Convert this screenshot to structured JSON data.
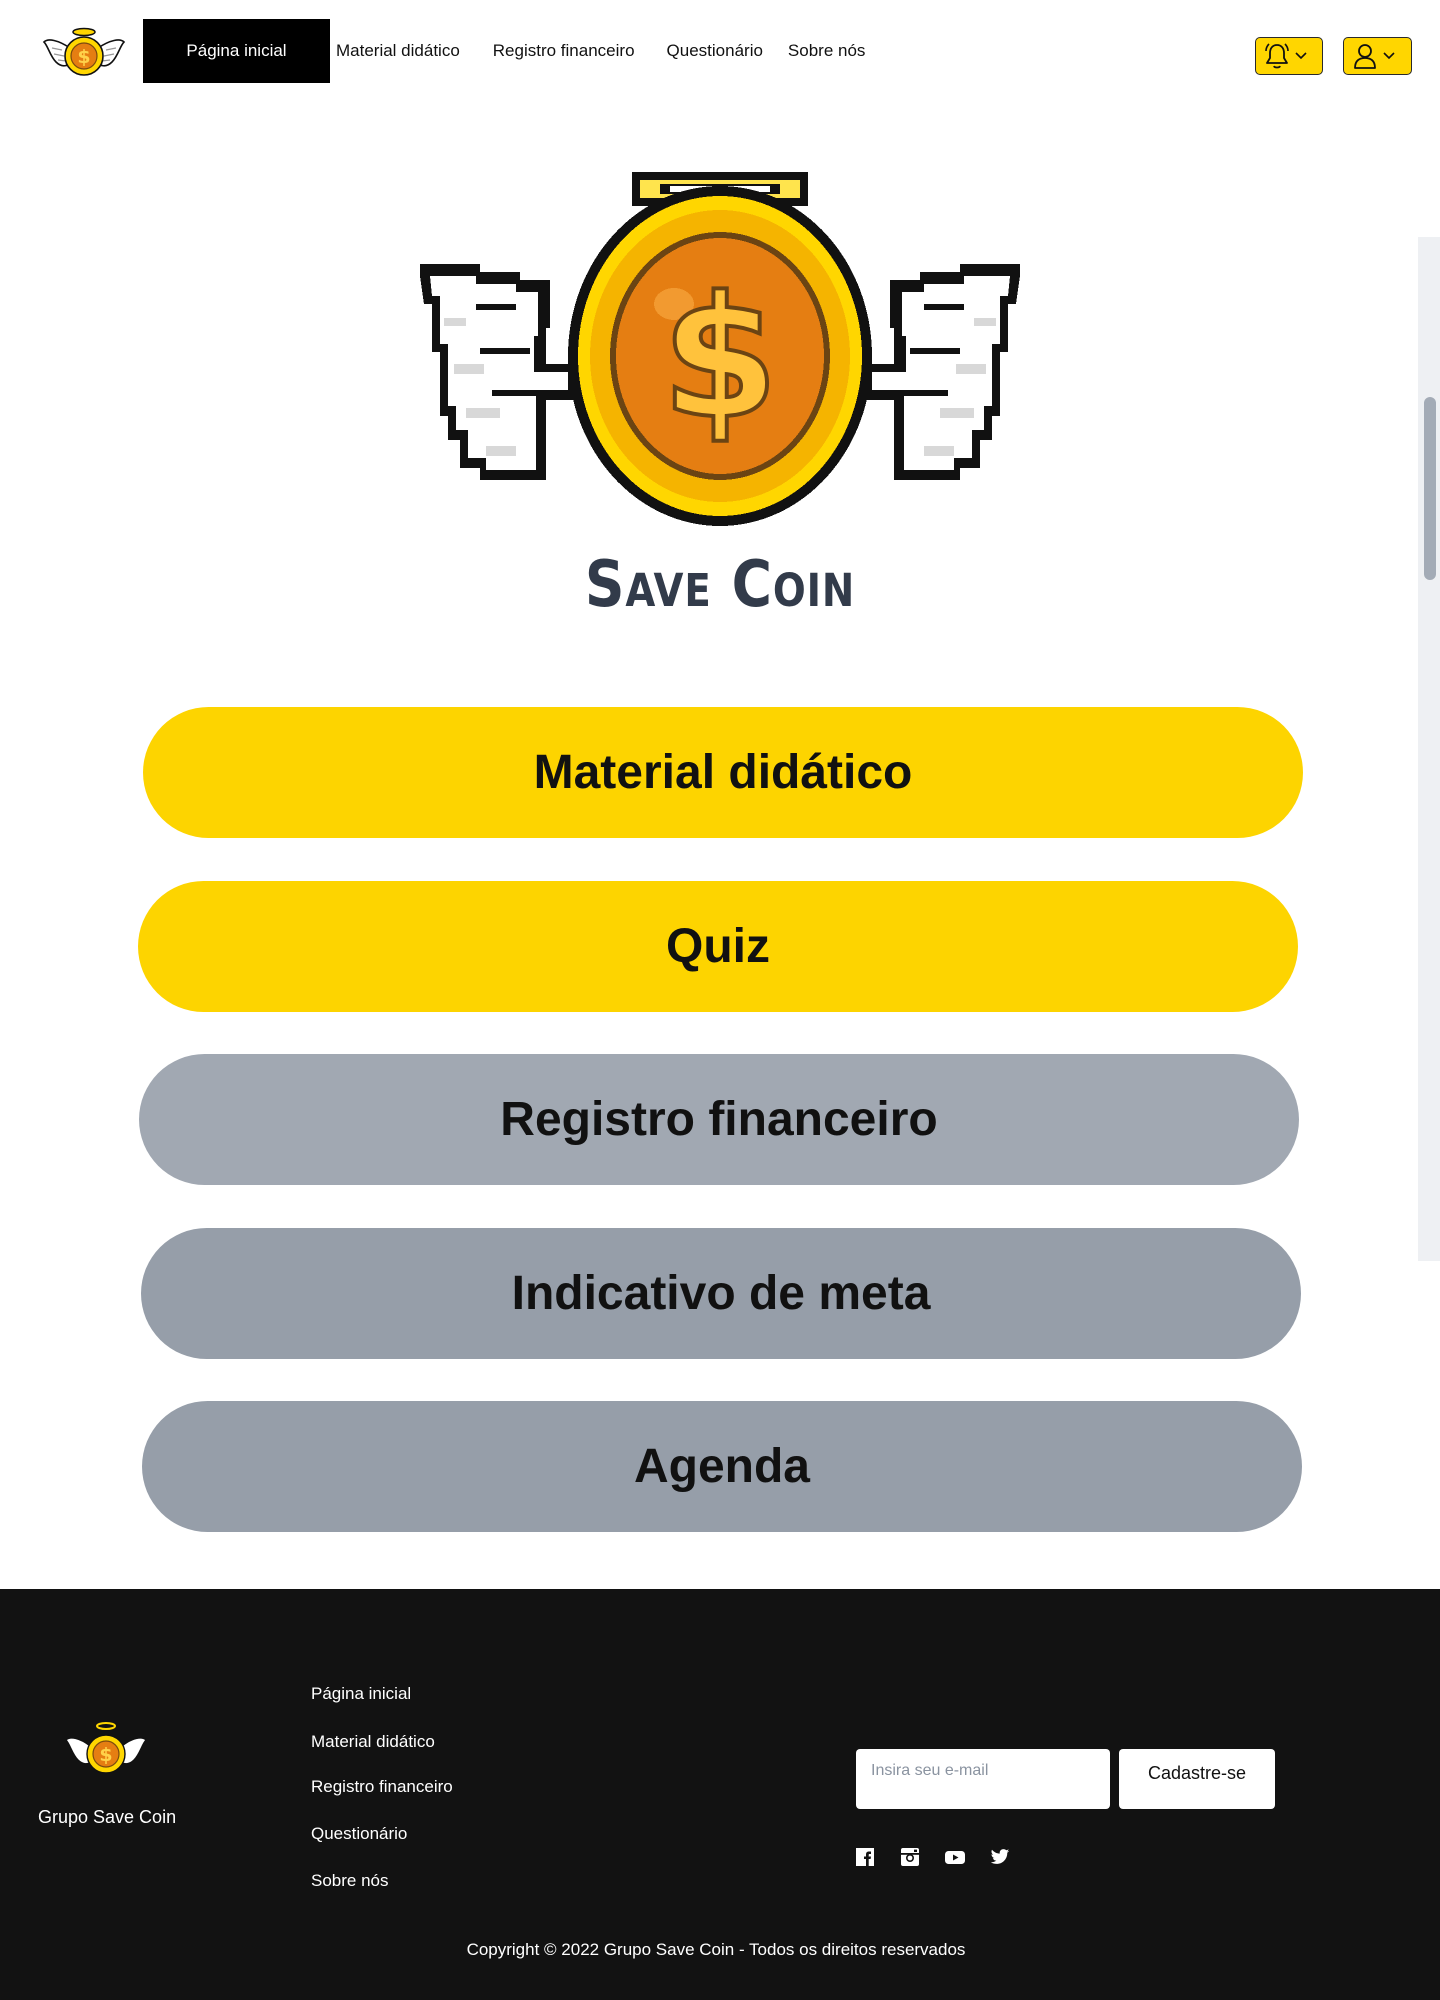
{
  "header": {
    "nav": [
      {
        "label": "Página inicial",
        "active": true
      },
      {
        "label": "Material didático"
      },
      {
        "label": "Registro financeiro"
      },
      {
        "label": "Questionário"
      },
      {
        "label": "Sobre nós"
      }
    ],
    "notifications_icon": "bell-icon",
    "profile_icon": "user-icon",
    "accent_color": "#FFD600"
  },
  "hero": {
    "title": "Save Coin",
    "logo_icon": "winged-coin-halo-logo"
  },
  "menu_buttons": [
    {
      "label": "Material didático",
      "color": "#FDD400"
    },
    {
      "label": "Quiz",
      "color": "#FDD400"
    },
    {
      "label": "Registro financeiro",
      "color": "#A1A8B2"
    },
    {
      "label": "Indicativo de meta",
      "color": "#969EA9"
    },
    {
      "label": "Agenda",
      "color": "#969EA9"
    }
  ],
  "footer": {
    "brand": "Grupo Save Coin",
    "links": [
      "Página inicial",
      "Material didático",
      "Registro financeiro",
      "Questionário",
      "Sobre nós"
    ],
    "email_placeholder": "Insira seu e-mail",
    "signup_label": "Cadastre-se",
    "social_icons": [
      "facebook-icon",
      "instagram-icon",
      "youtube-icon",
      "twitter-icon"
    ],
    "copyright": "Copyright © 2022 Grupo Save Coin - Todos os direitos reservados",
    "background": "#121212"
  }
}
